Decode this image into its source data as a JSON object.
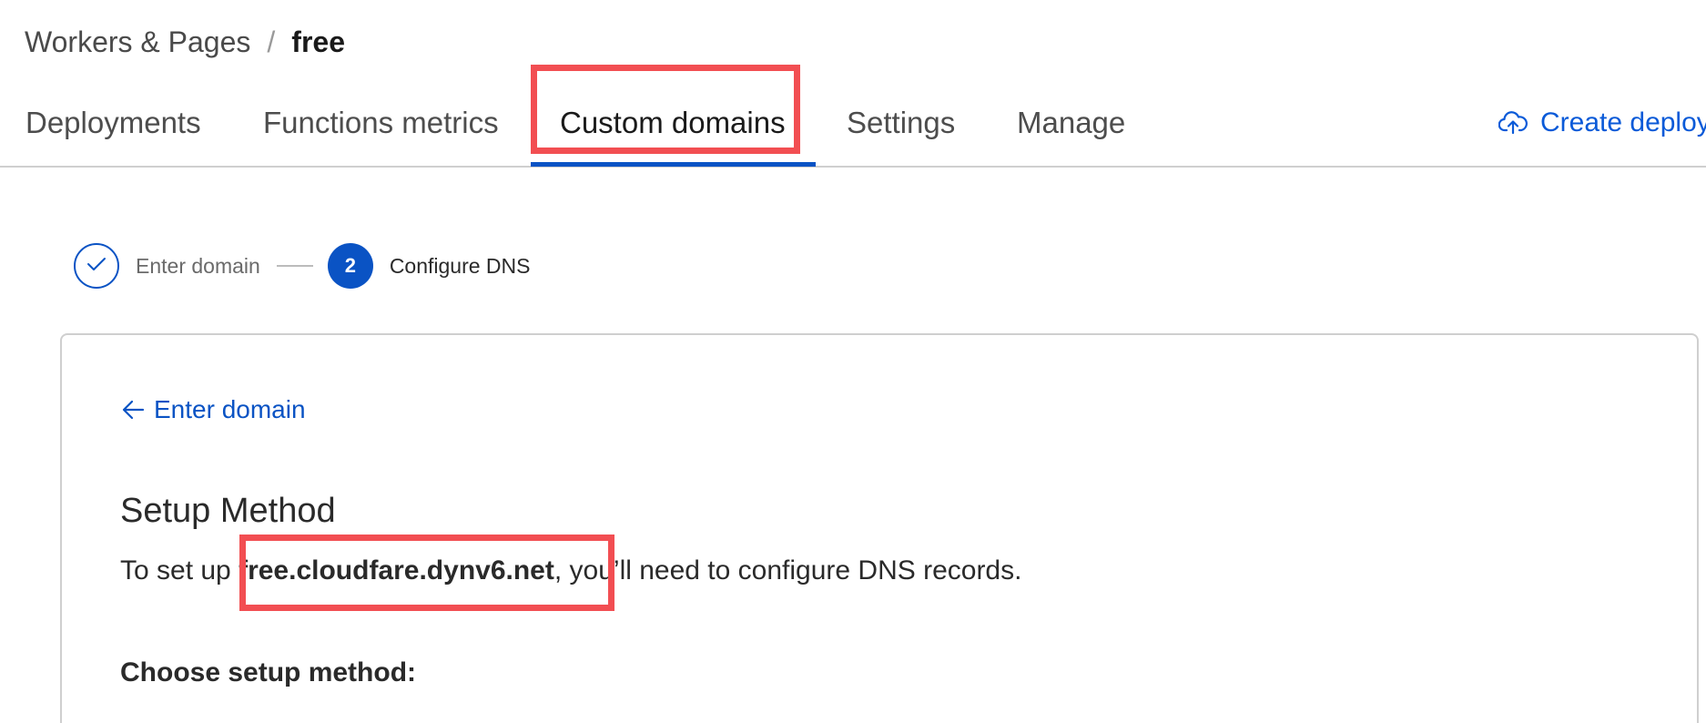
{
  "breadcrumb": {
    "parent": "Workers & Pages",
    "separator": "/",
    "current": "free"
  },
  "tabs": [
    {
      "label": "Deployments",
      "active": false
    },
    {
      "label": "Functions metrics",
      "active": false
    },
    {
      "label": "Custom domains",
      "active": true
    },
    {
      "label": "Settings",
      "active": false
    },
    {
      "label": "Manage",
      "active": false
    }
  ],
  "header_actions": {
    "create_deploy_label": "Create deploy",
    "create_deploy_icon": "cloud-upload-icon"
  },
  "stepper": {
    "steps": [
      {
        "label": "Enter domain",
        "status": "complete",
        "icon": "check-icon"
      },
      {
        "number": "2",
        "label": "Configure DNS",
        "status": "active"
      }
    ]
  },
  "card": {
    "back_link_label": "Enter domain",
    "back_link_icon": "arrow-left-icon",
    "title": "Setup Method",
    "description_prefix": "To set up ",
    "domain": "free.cloudfare.dynv6.net",
    "description_suffix": ", you’ll need to configure DNS records.",
    "choose_label": "Choose setup method:"
  },
  "colors": {
    "accent": "#0a53c4",
    "link": "#0a5ad8",
    "highlight": "#f24e52",
    "border": "#cfcfcf"
  }
}
